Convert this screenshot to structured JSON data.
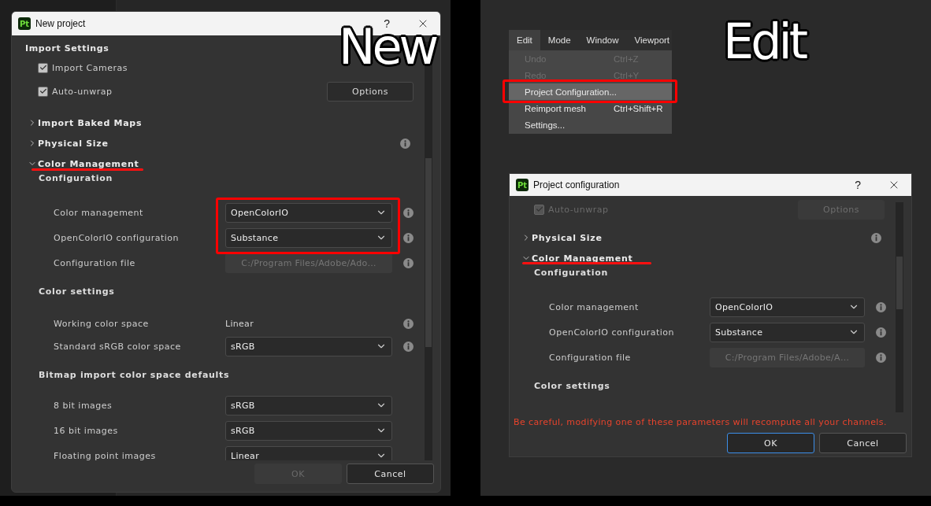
{
  "new_pane": {
    "annotation": "New",
    "dialog": {
      "badge": "Pt",
      "title": "New project",
      "help": "?",
      "heading": "Import Settings",
      "checks": [
        {
          "label": "Import Cameras",
          "checked": true,
          "disabled": false
        },
        {
          "label": "Auto-unwrap",
          "checked": true,
          "disabled": false,
          "button": {
            "label": "Options",
            "disabled": false
          }
        }
      ],
      "sections": [
        {
          "label": "Import Baked Maps",
          "expanded": false,
          "info": false
        },
        {
          "label": "Physical Size",
          "expanded": false,
          "info": true
        },
        {
          "label": "Color Management",
          "expanded": true,
          "info": false
        }
      ],
      "groups": [
        {
          "title": "Configuration",
          "rows": [
            {
              "kind": "select",
              "label": "Color management",
              "value": "OpenColorIO",
              "info": true
            },
            {
              "kind": "select",
              "label": "OpenColorIO configuration",
              "value": "Substance",
              "info": true
            },
            {
              "kind": "file",
              "label": "Configuration file",
              "value": "C:/Program Files/Adobe/Ado…",
              "info": true
            }
          ]
        },
        {
          "title": "Color settings",
          "rows": [
            {
              "kind": "text",
              "label": "Working color space",
              "value": "Linear",
              "info": true
            },
            {
              "kind": "select",
              "label": "Standard sRGB color space",
              "value": "sRGB",
              "info": true
            }
          ]
        },
        {
          "title": "Bitmap import color space defaults",
          "rows": [
            {
              "kind": "select",
              "label": "8 bit images",
              "value": "sRGB",
              "info": false
            },
            {
              "kind": "select",
              "label": "16 bit images",
              "value": "sRGB",
              "info": false
            },
            {
              "kind": "select",
              "label": "Floating point images",
              "value": "Linear",
              "info": false
            }
          ]
        }
      ],
      "buttons": [
        {
          "label": "OK",
          "disabled": true,
          "default": false
        },
        {
          "label": "Cancel",
          "disabled": false,
          "default": false
        }
      ]
    }
  },
  "edit_pane": {
    "annotation": "Edit",
    "menu": {
      "bar": [
        {
          "label": "Edit",
          "selected": true
        },
        {
          "label": "Mode",
          "selected": false
        },
        {
          "label": "Window",
          "selected": false
        },
        {
          "label": "Viewport",
          "selected": false
        }
      ],
      "items": [
        {
          "label": "Undo",
          "shortcut": "Ctrl+Z",
          "disabled": true,
          "selected": false
        },
        {
          "label": "Redo",
          "shortcut": "Ctrl+Y",
          "disabled": true,
          "selected": false
        },
        {
          "label": "Project Configuration...",
          "disabled": false,
          "selected": true
        },
        {
          "label": "Reimport mesh",
          "shortcut": "Ctrl+Shift+R",
          "disabled": false,
          "selected": false
        },
        {
          "label": "Settings...",
          "disabled": false,
          "selected": false
        }
      ]
    },
    "dialog": {
      "badge": "Pt",
      "title": "Project configuration",
      "help": "?",
      "checks": [
        {
          "label": "Auto-unwrap",
          "checked": true,
          "disabled": true,
          "button": {
            "label": "Options",
            "disabled": true
          }
        }
      ],
      "sections": [
        {
          "label": "Physical Size",
          "expanded": false,
          "info": true
        },
        {
          "label": "Color Management",
          "expanded": true,
          "info": false
        }
      ],
      "groups": [
        {
          "title": "Configuration",
          "rows": [
            {
              "kind": "select",
              "label": "Color management",
              "value": "OpenColorIO",
              "info": true
            },
            {
              "kind": "select",
              "label": "OpenColorIO configuration",
              "value": "Substance",
              "info": true
            },
            {
              "kind": "file",
              "label": "Configuration file",
              "value": "C:/Program Files/Adobe/A…",
              "info": true
            }
          ]
        },
        {
          "title": "Color settings"
        }
      ],
      "warning": "Be careful, modifying one of these parameters will recompute all your channels.",
      "buttons": [
        {
          "label": "OK",
          "disabled": false,
          "default": true
        },
        {
          "label": "Cancel",
          "disabled": false,
          "default": false
        }
      ]
    }
  }
}
